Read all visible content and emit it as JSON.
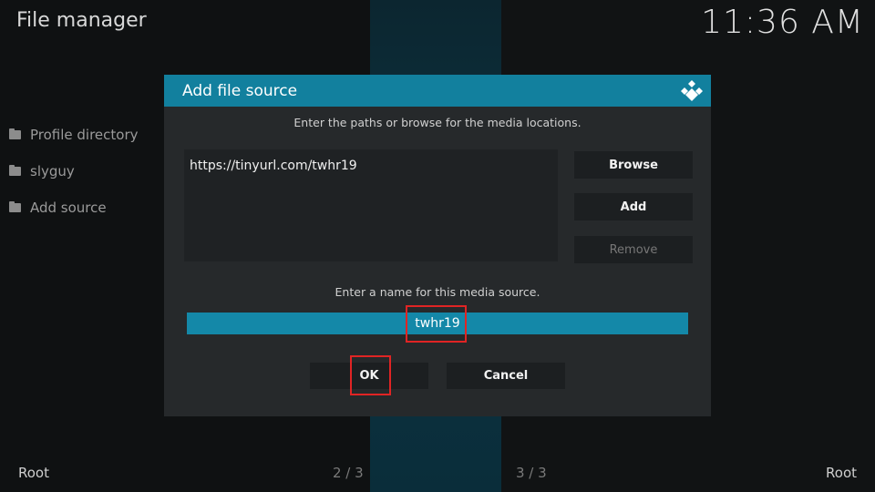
{
  "app": {
    "title": "File manager",
    "clock": "11:36 AM"
  },
  "left_list": {
    "items": [
      {
        "label": "Profile directory",
        "icon": "folder-icon"
      },
      {
        "label": "slyguy",
        "icon": "folder-icon"
      },
      {
        "label": "Add source",
        "icon": "folder-icon"
      }
    ]
  },
  "footer": {
    "left": "Root",
    "page_left": "2 / 3",
    "page_right": "3 / 3",
    "right": "Root"
  },
  "dialog": {
    "title": "Add file source",
    "instruction_paths": "Enter the paths or browse for the media locations.",
    "paths": [
      "https://tinyurl.com/twhr19"
    ],
    "buttons": {
      "browse": "Browse",
      "add": "Add",
      "remove": "Remove"
    },
    "instruction_name": "Enter a name for this media source.",
    "name_value": "twhr19",
    "ok": "OK",
    "cancel": "Cancel",
    "accent_color": "#12809e",
    "highlight_color": "#e02424"
  }
}
